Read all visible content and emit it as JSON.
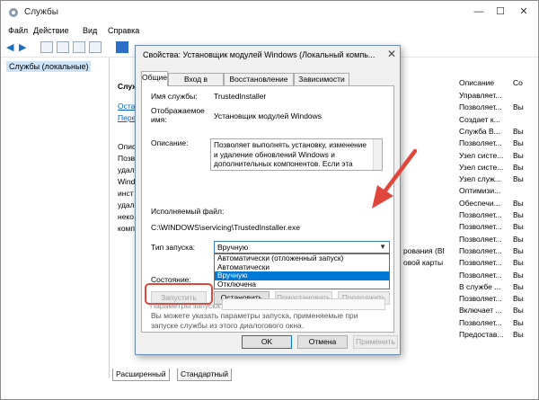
{
  "window": {
    "title": "Службы",
    "min": "—",
    "max": "☐",
    "close": "✕"
  },
  "menu": [
    "Файл",
    "Действие",
    "Вид",
    "Справка"
  ],
  "tree": {
    "root": "Службы (локальные)"
  },
  "main": {
    "header_left": "Служб",
    "links": [
      "Остан",
      "Перез"
    ],
    "desc_lines": [
      "Описа",
      "Позво",
      "удале",
      "Windo",
      "инст",
      "удал",
      "неко",
      "комп"
    ],
    "col_desc_header": "Описание",
    "col_state_header": "Со",
    "rows": [
      {
        "desc": "Управляет...",
        "state": ""
      },
      {
        "desc": "Позволяет...",
        "state": "Вы"
      },
      {
        "desc": "Создает к...",
        "state": ""
      },
      {
        "desc": "Служба B...",
        "state": "Вы"
      },
      {
        "desc": "Позволяет...",
        "state": "Вы"
      },
      {
        "desc": "Узел систе...",
        "state": "Вы"
      },
      {
        "desc": "Узел систе...",
        "state": "Вы"
      },
      {
        "desc": "Узел служ...",
        "state": "Вы"
      },
      {
        "desc": "Оптимизи...",
        "state": ""
      },
      {
        "desc": "Обеспечи...",
        "state": "Вы"
      },
      {
        "desc": "Позволяет...",
        "state": "Вы"
      },
      {
        "desc": "Позволяет...",
        "state": "Вы"
      },
      {
        "desc": "Позволяет...",
        "state": "Вы"
      },
      {
        "desc": "Позволяет...",
        "state": "Вы"
      },
      {
        "desc": "Позволяет...",
        "state": "Вы"
      },
      {
        "desc": "Позволяет...",
        "state": "Вы"
      },
      {
        "desc": "В службе ...",
        "state": "Вы"
      },
      {
        "desc": "Позволяет...",
        "state": "Вы"
      },
      {
        "desc": "Включает ...",
        "state": "Вы"
      },
      {
        "desc": "Позволяет...",
        "state": "Вы"
      },
      {
        "desc": "Предостав...",
        "state": "Вы"
      }
    ],
    "partial_rows": [
      {
        "text": "рования (BI",
        "row": 13
      },
      {
        "text": "овой карты",
        "row": 14
      }
    ]
  },
  "bottom_tabs": [
    "Расширенный",
    "Стандартный"
  ],
  "dialog": {
    "title": "Свойства: Установщик модулей Windows (Локальный компь...",
    "close": "✕",
    "tabs": [
      "Общие",
      "Вход в систему",
      "Восстановление",
      "Зависимости"
    ],
    "service_name_label": "Имя службы:",
    "service_name": "TrustedInstaller",
    "display_name_label": "Отображаемое имя:",
    "display_name": "Установщик модулей Windows",
    "description_label": "Описание:",
    "description": "Позволяет выполнять установку, изменение и удаление обновлений Windows и дополнительных компонентов. Если эта служба отключена, установка или удаление обновлений",
    "exe_label": "Исполняемый файл:",
    "exe_path": "C:\\WINDOWS\\servicing\\TrustedInstaller.exe",
    "startup_label": "Тип запуска:",
    "startup_value": "Вручную",
    "startup_options": [
      "Автоматически (отложенный запуск)",
      "Автоматически",
      "Вручную",
      "Отключена"
    ],
    "startup_selected": "Вручную",
    "state_label": "Состояние:",
    "buttons": {
      "start": "Запустить",
      "stop": "Остановить",
      "pause": "Приостановить",
      "resume": "Продолжить"
    },
    "hint": "Вы можете указать параметры запуска, применяемые при запуске службы из этого диалогового окна.",
    "params_label": "Параметры запуска:",
    "ok": "OK",
    "cancel": "Отмена",
    "apply": "Применить"
  },
  "colors": {
    "highlight": "#e0463c",
    "accent": "#0078d7"
  }
}
